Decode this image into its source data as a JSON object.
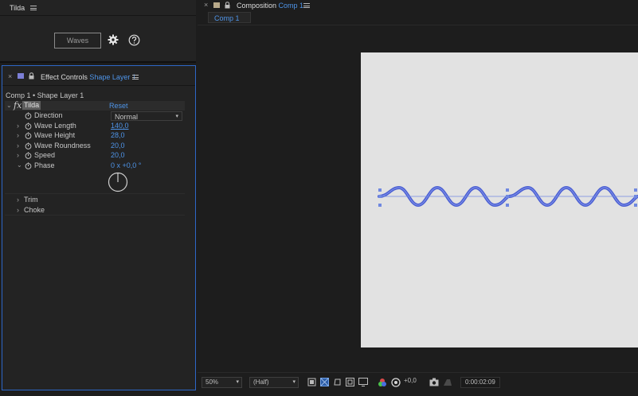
{
  "tilda_panel": {
    "title": "Tilda",
    "button_label": "Waves"
  },
  "effect_controls": {
    "tab_title": "Effect Controls",
    "tab_layer": "Shape Layer 1",
    "breadcrumb": "Comp 1 • Shape Layer 1",
    "effect_name": "Tilda",
    "reset_label": "Reset",
    "direction": {
      "label": "Direction",
      "value": "Normal"
    },
    "properties": [
      {
        "label": "Wave Length",
        "value": "140,0"
      },
      {
        "label": "Wave Height",
        "value": "28,0"
      },
      {
        "label": "Wave Roundness",
        "value": "20,0"
      },
      {
        "label": "Speed",
        "value": "20,0"
      },
      {
        "label": "Phase",
        "value": "0 x +0,0 °"
      }
    ],
    "groups": [
      "Trim",
      "Choke"
    ]
  },
  "composition": {
    "tab_prefix": "Composition",
    "tab_name": "Comp 1",
    "sub_tab": "Comp 1",
    "zoom": "50%",
    "resolution": "(Half)",
    "exposure": "+0,0",
    "timecode": "0:00:02:09"
  },
  "colors": {
    "accent": "#4e94e8",
    "wave": "#4a5ed2",
    "selection": "#7088e0"
  }
}
